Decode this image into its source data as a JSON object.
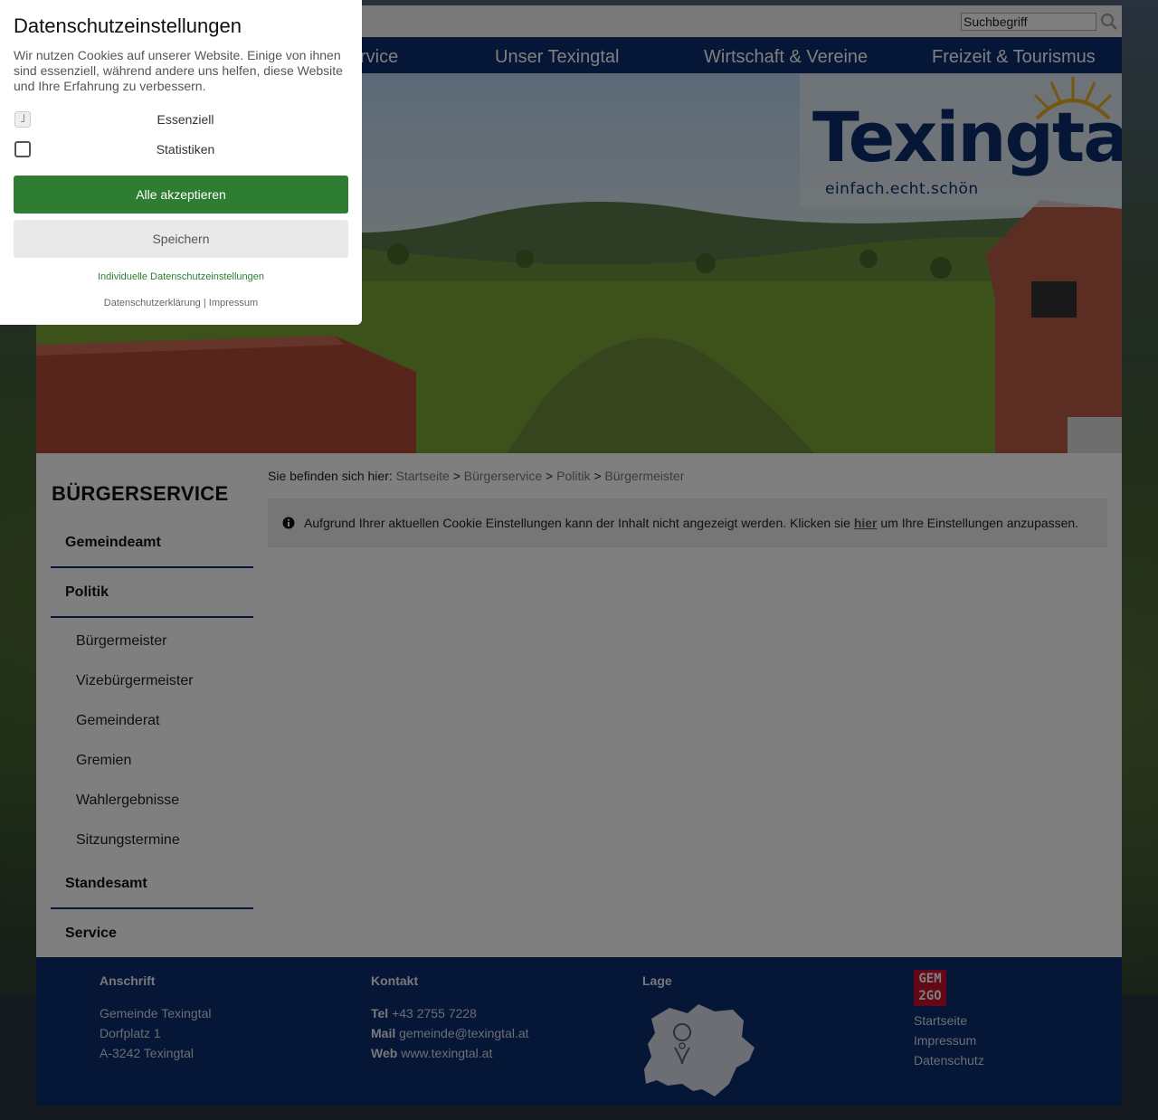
{
  "cookie_dialog": {
    "title": "Datenschutzeinstellungen",
    "description": "Wir nutzen Cookies auf unserer Website. Einige von ihnen sind essenziell, während andere uns helfen, diese Website und Ihre Erfahrung zu verbessern.",
    "options": [
      {
        "label": "Essenziell",
        "checked": true,
        "disabled": true
      },
      {
        "label": "Statistiken",
        "checked": false,
        "disabled": false
      }
    ],
    "accept_all_label": "Alle akzeptieren",
    "save_label": "Speichern",
    "individual_label": "Individuelle Datenschutzeinstellungen",
    "privacy_label": "Datenschutzerklärung",
    "separator": "|",
    "imprint_label": "Impressum"
  },
  "header": {
    "search_placeholder": "Suchbegriff",
    "nav": [
      "rvice",
      "Unser Texingtal",
      "Wirtschaft & Vereine",
      "Freizeit & Tourismus"
    ]
  },
  "logo": {
    "name": "Texingtal",
    "tagline": "einfach.echt.schön"
  },
  "sidebar": {
    "title": "BÜRGERSERVICE",
    "items": [
      {
        "label": "Gemeindeamt"
      },
      {
        "label": "Politik",
        "children": [
          "Bürgermeister",
          "Vizebürgermeister",
          "Gemeinderat",
          "Gremien",
          "Wahlergebnisse",
          "Sitzungstermine"
        ]
      },
      {
        "label": "Standesamt"
      },
      {
        "label": "Service"
      }
    ]
  },
  "breadcrumb": {
    "prefix": "Sie befinden sich hier:",
    "items": [
      "Startseite",
      "Bürgerservice",
      "Politik",
      "Bürgermeister"
    ],
    "separator": ">"
  },
  "notice": {
    "text_before": "Aufgrund Ihrer aktuellen Cookie Einstellungen kann der Inhalt nicht angezeigt werden. Klicken sie",
    "link_label": "hier",
    "text_after": "um Ihre Einstellungen anzupassen."
  },
  "footer": {
    "address": {
      "heading": "Anschrift",
      "lines": [
        "Gemeinde Texingtal",
        "Dorfplatz 1",
        "A-3242 Texingtal"
      ]
    },
    "contact": {
      "heading": "Kontakt",
      "tel_label": "Tel",
      "tel": "+43 2755 7228",
      "mail_label": "Mail",
      "mail": "gemeinde@texingtal.at",
      "web_label": "Web",
      "web": "www.texingtal.at"
    },
    "location": {
      "heading": "Lage"
    },
    "gem2go": {
      "logo_lines": [
        "GEM",
        "2GO"
      ],
      "links": [
        "Startseite",
        "Impressum",
        "Datenschutz"
      ]
    }
  },
  "colors": {
    "brand_blue": "#0b2d6e",
    "accept_green": "#2e7d32",
    "gem2go_red": "#c8102e"
  }
}
